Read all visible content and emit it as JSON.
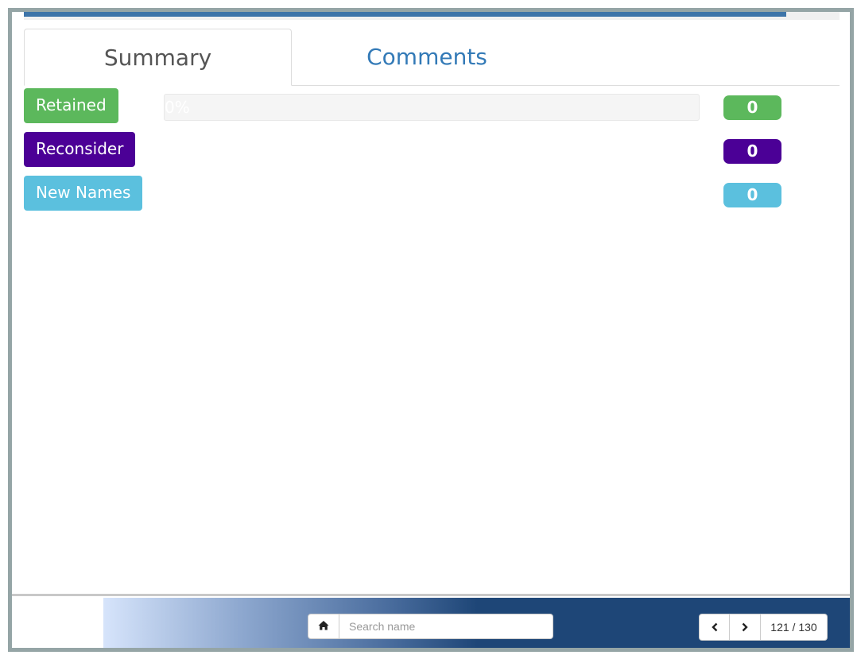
{
  "top_progress": {
    "fraction": 0.935,
    "fill_color": "#3d74a8"
  },
  "tabs": [
    {
      "label": "Summary",
      "active": true
    },
    {
      "label": "Comments",
      "active": false
    }
  ],
  "summary": {
    "categories": [
      {
        "label": "Retained",
        "count": "0",
        "color": "#5cb85c",
        "progress_text": "0%",
        "progress_fraction": 0
      },
      {
        "label": "Reconsider",
        "count": "0",
        "color": "#4b0096"
      },
      {
        "label": "New Names",
        "count": "0",
        "color": "#5bc0de"
      }
    ]
  },
  "footer": {
    "home_icon": "home-icon",
    "search": {
      "placeholder": "Search name",
      "value": ""
    },
    "pager": {
      "prev_icon": "chevron-left-icon",
      "next_icon": "chevron-right-icon",
      "indicator": "121 / 130"
    },
    "gradient": {
      "start": "#d6e4fb",
      "end": "#1e4677"
    }
  }
}
